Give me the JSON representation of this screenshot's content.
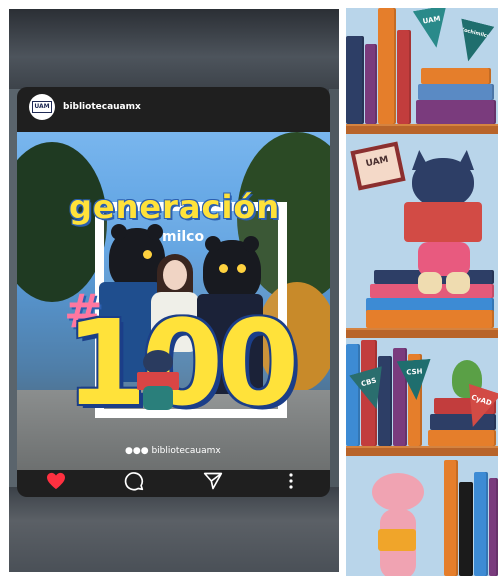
{
  "post": {
    "username": "bibliotecauamx",
    "avatar_text": "UAM",
    "headline": "generación",
    "hash": "#",
    "number": "100",
    "frame_text": "milco",
    "watermark": "bibliotecauamx",
    "actions": [
      "like-icon",
      "comment-icon",
      "share-icon",
      "more-icon"
    ],
    "colors": {
      "like": "#ff3040",
      "headline": "#ffe23a",
      "outline": "#1b3e88"
    }
  },
  "illustration": {
    "pennants": [
      {
        "text": "UAM",
        "color": "#2a8a8a"
      },
      {
        "text": "Xochimilco",
        "color": "#1f6e6e"
      },
      {
        "text": "CBS",
        "color": "#2a6e6e"
      },
      {
        "text": "CSH",
        "color": "#1f6e6e"
      },
      {
        "text": "CyAD",
        "color": "#d24b45"
      }
    ],
    "sign_text": "UAM"
  }
}
